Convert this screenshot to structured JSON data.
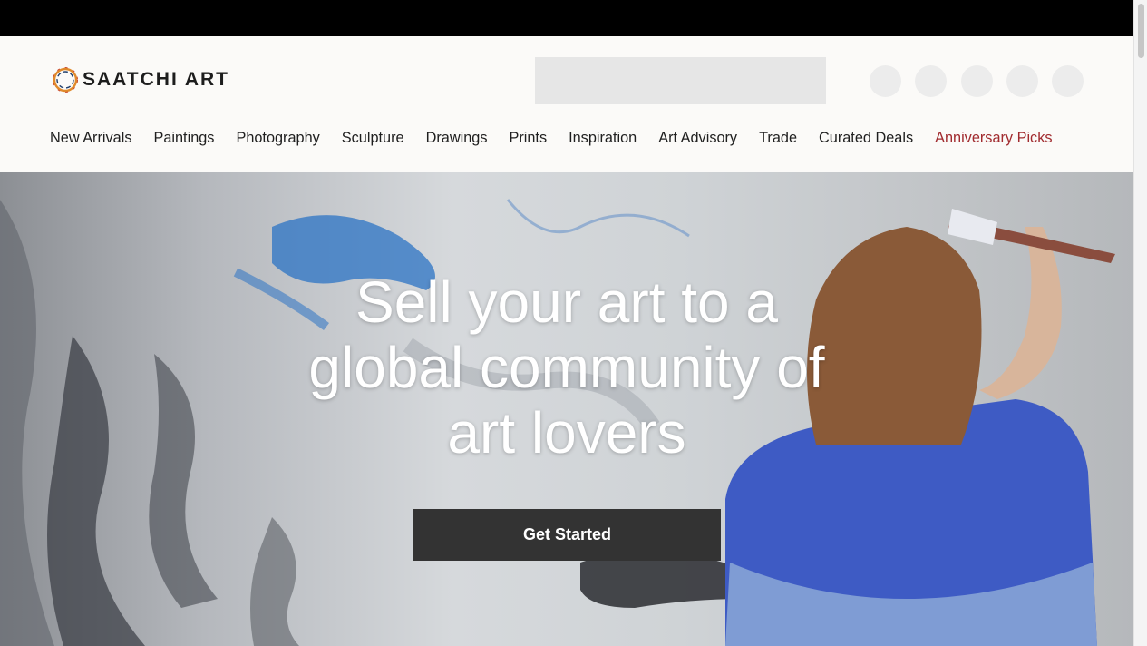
{
  "brand": {
    "name": "SAATCHI ART"
  },
  "search": {
    "placeholder": ""
  },
  "header_icons": [
    "user-icon",
    "globe-icon",
    "message-icon",
    "heart-icon",
    "cart-icon"
  ],
  "nav": {
    "items": [
      {
        "label": "New Arrivals"
      },
      {
        "label": "Paintings"
      },
      {
        "label": "Photography"
      },
      {
        "label": "Sculpture"
      },
      {
        "label": "Drawings"
      },
      {
        "label": "Prints"
      },
      {
        "label": "Inspiration"
      },
      {
        "label": "Art Advisory"
      },
      {
        "label": "Trade"
      },
      {
        "label": "Curated Deals"
      },
      {
        "label": "Anniversary Picks"
      }
    ]
  },
  "hero": {
    "title_line1": "Sell your art to a",
    "title_line2": "global community of",
    "title_line3": "art lovers",
    "cta_label": "Get Started"
  },
  "colors": {
    "accent_nav": "#a12b2f",
    "cta_background": "#333333",
    "header_background": "#fbfaf8",
    "top_bar": "#000000"
  }
}
